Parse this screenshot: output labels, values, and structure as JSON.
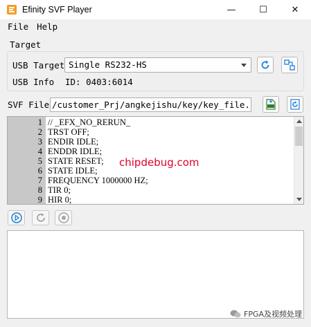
{
  "window": {
    "title": "Efinity SVF Player",
    "minimize_glyph": "—",
    "maximize_glyph": "☐",
    "close_glyph": "✕"
  },
  "menu": {
    "items": [
      "File",
      "Help"
    ]
  },
  "target": {
    "group_label": "Target",
    "usb_target_label": "USB Target",
    "usb_target_value": "Single RS232-HS",
    "usb_info_label": "USB Info",
    "usb_info_value": "ID: 0403:6014"
  },
  "svf": {
    "label": "SVF File",
    "path": "/customer_Prj/angkejishu/key/key_file.svf"
  },
  "editor": {
    "lines": [
      {
        "num": "1",
        "text": "// _EFX_NO_RERUN_"
      },
      {
        "num": "2",
        "text": "TRST OFF;"
      },
      {
        "num": "3",
        "text": "ENDIR IDLE;"
      },
      {
        "num": "4",
        "text": "ENDDR IDLE;"
      },
      {
        "num": "5",
        "text": "STATE RESET;"
      },
      {
        "num": "6",
        "text": "STATE IDLE;"
      },
      {
        "num": "7",
        "text": "FREQUENCY 1000000 HZ;"
      },
      {
        "num": "8",
        "text": "TIR 0;"
      },
      {
        "num": "9",
        "text": "HIR 0;"
      }
    ]
  },
  "watermark": {
    "text": "chipdebug.com"
  },
  "footer": {
    "text": "FPGA及视频处理"
  },
  "colors": {
    "accent_blue": "#1e7fd6",
    "gutter": "#c8c8c8",
    "watermark_red": "#e0002a"
  }
}
